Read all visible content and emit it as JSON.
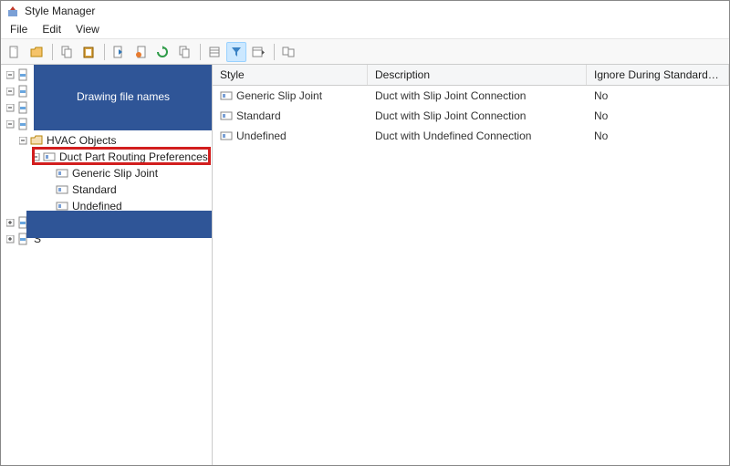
{
  "window": {
    "title": "Style Manager"
  },
  "menu": {
    "file": "File",
    "edit": "Edit",
    "view": "View"
  },
  "annotations": {
    "drawing_files": "Drawing file names"
  },
  "tree": {
    "hvac": "HVAC Objects",
    "dprp": "Duct Part Routing Preferences",
    "gsj": "Generic Slip Joint",
    "std": "Standard",
    "und": "Undefined"
  },
  "grid": {
    "headers": {
      "style": "Style",
      "desc": "Description",
      "ignore": "Ignore During Standards Synchro..."
    },
    "rows": [
      {
        "style": "Generic Slip Joint",
        "desc": "Duct with Slip Joint Connection",
        "ignore": "No"
      },
      {
        "style": "Standard",
        "desc": "Duct with Slip Joint Connection",
        "ignore": "No"
      },
      {
        "style": "Undefined",
        "desc": "Duct with Undefined Connection",
        "ignore": "No"
      }
    ]
  }
}
